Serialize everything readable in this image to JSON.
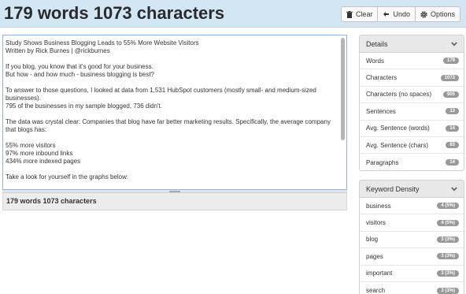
{
  "header": {
    "title": "179 words 1073 characters",
    "buttons": {
      "clear": "Clear",
      "undo": "Undo",
      "options": "Options"
    }
  },
  "editor": {
    "paragraphs": [
      "Study Shows Business Blogging Leads to 55% More Website Visitors\nWritten by Rick Burnes | @rickburnes",
      "If you blog, you know that it's good for your business.\nBut how - and how much - business blogging is best?",
      "To answer to those questions, I looked at data from 1,531 HubSpot customers (mostly small- and medium-sized businesses).\n795 of the businesses in my sample blogged, 736 didn't.",
      "The data was crystal clear: Companies that blog have far better marketing results. Specifically, the average company that blogs has:",
      "55% more visitors\n97% more inbound links\n434% more indexed pages",
      "Take a look for yourself in the graphs below:"
    ]
  },
  "footer": {
    "count": "179 words 1073 characters"
  },
  "details": {
    "title": "Details",
    "rows": [
      {
        "label": "Words",
        "value": "179"
      },
      {
        "label": "Characters",
        "value": "1073"
      },
      {
        "label": "Characters (no spaces)",
        "value": "905"
      },
      {
        "label": "Sentences",
        "value": "13"
      },
      {
        "label": "Avg. Sentence (words)",
        "value": "14"
      },
      {
        "label": "Avg. Sentence (chars)",
        "value": "83"
      },
      {
        "label": "Paragraphs",
        "value": "14"
      }
    ]
  },
  "keyword_density": {
    "title": "Keyword Density",
    "rows": [
      {
        "label": "business",
        "value": "4 (5%)"
      },
      {
        "label": "visitors",
        "value": "4 (5%)"
      },
      {
        "label": "blog",
        "value": "3 (3%)"
      },
      {
        "label": "pages",
        "value": "3 (3%)"
      },
      {
        "label": "important",
        "value": "3 (3%)"
      },
      {
        "label": "search",
        "value": "3 (3%)"
      }
    ]
  }
}
